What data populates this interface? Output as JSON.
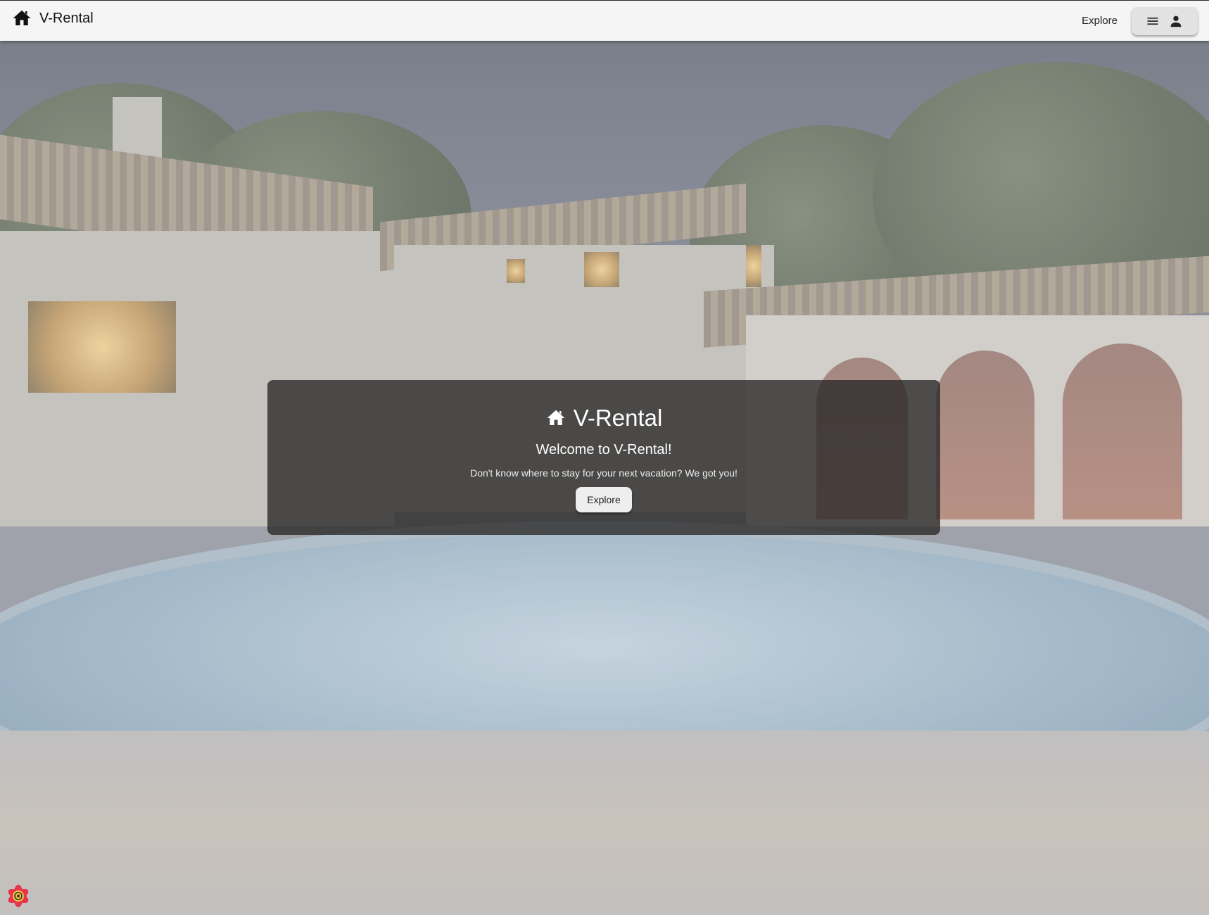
{
  "navbar": {
    "brand_icon": "home-icon",
    "brand_text": "V-Rental",
    "explore_label": "Explore",
    "account_menu_icons": [
      "menu-icon",
      "person-icon"
    ]
  },
  "hero": {
    "background": "night villa courtyard with pool (photo)",
    "card": {
      "icon": "home-icon",
      "title": "V-Rental",
      "subtitle": "Welcome to V-Rental!",
      "description": "Don't know where to stay for your next vacation? We got you!",
      "button_label": "Explore"
    }
  },
  "floating_icon": "flower-debug-icon",
  "colors": {
    "navbar_bg": "#f5f5f5",
    "card_bg": "rgba(40,38,38,0.78)",
    "button_bg": "#eeeeee",
    "fab_accent": "#e6344a"
  }
}
